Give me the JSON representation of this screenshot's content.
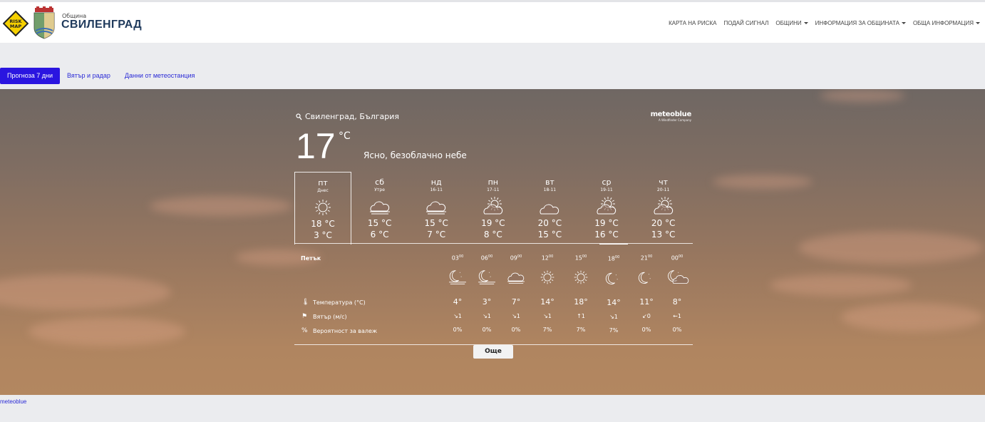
{
  "header": {
    "logo_text": "RISK MAP",
    "brand_small": "Община",
    "brand_big": "СВИЛЕНГРАД",
    "nav": [
      {
        "label": "КАРТА НА РИСКА",
        "dropdown": false
      },
      {
        "label": "ПОДАЙ СИГНАЛ",
        "dropdown": false
      },
      {
        "label": "ОБЩИНИ",
        "dropdown": true
      },
      {
        "label": "ИНФОРМАЦИЯ ЗА ОБЩИНАТА",
        "dropdown": true
      },
      {
        "label": "ОБЩА ИНФОРМАЦИЯ",
        "dropdown": true
      }
    ]
  },
  "tabs": [
    {
      "label": "Прогноза 7 дни",
      "active": true
    },
    {
      "label": "Вятър и радар",
      "active": false
    },
    {
      "label": "Данни от метеостанция",
      "active": false
    }
  ],
  "widget": {
    "location": "Свиленград, България",
    "provider": "meteoblue",
    "provider_sub": "A Windfinder Company",
    "current_temp": "17",
    "unit": "°C",
    "condition": "Ясно, безоблачно небе",
    "days": [
      {
        "name": "пт",
        "date": "Днес",
        "icon": "sun-icon",
        "hi": "18 °C",
        "lo": "3 °C",
        "selected": true
      },
      {
        "name": "сб",
        "date": "Утре",
        "icon": "fog-cloud-icon",
        "hi": "15 °C",
        "lo": "6 °C",
        "selected": false
      },
      {
        "name": "нд",
        "date": "16-11",
        "icon": "fog-cloud-icon",
        "hi": "15 °C",
        "lo": "7 °C",
        "selected": false
      },
      {
        "name": "пн",
        "date": "17-11",
        "icon": "sun-cloud-icon",
        "hi": "19 °C",
        "lo": "8 °C",
        "selected": false
      },
      {
        "name": "вт",
        "date": "18-11",
        "icon": "cloud-icon",
        "hi": "20 °C",
        "lo": "15 °C",
        "selected": false
      },
      {
        "name": "ср",
        "date": "19-11",
        "icon": "sun-cloud-icon",
        "hi": "19 °C",
        "lo": "16 °C",
        "selected": false
      },
      {
        "name": "чт",
        "date": "20-11",
        "icon": "sun-cloud-icon",
        "hi": "20 °C",
        "lo": "13 °C",
        "selected": false
      }
    ],
    "hourly_day": "Петък",
    "row_labels": {
      "temp": "Температура (°C)",
      "wind": "Вятър (м/с)",
      "precip": "Вероятност за валеж"
    },
    "hours": [
      {
        "h": "03",
        "m": "00",
        "icon": "moon-fog-icon",
        "temp": "4°",
        "wind": "1",
        "wind_dir": "↘",
        "precip": "0%"
      },
      {
        "h": "06",
        "m": "00",
        "icon": "moon-fog-icon",
        "temp": "3°",
        "wind": "1",
        "wind_dir": "↘",
        "precip": "0%"
      },
      {
        "h": "09",
        "m": "00",
        "icon": "fog-cloud-icon",
        "temp": "7°",
        "wind": "1",
        "wind_dir": "↘",
        "precip": "0%"
      },
      {
        "h": "12",
        "m": "00",
        "icon": "sun-icon",
        "temp": "14°",
        "wind": "1",
        "wind_dir": "↘",
        "precip": "7%"
      },
      {
        "h": "15",
        "m": "00",
        "icon": "sun-icon",
        "temp": "18°",
        "wind": "1",
        "wind_dir": "↑",
        "precip": "7%"
      },
      {
        "h": "18",
        "m": "00",
        "icon": "moon-icon",
        "temp": "14°",
        "wind": "1",
        "wind_dir": "↘",
        "precip": "7%"
      },
      {
        "h": "21",
        "m": "00",
        "icon": "moon-icon",
        "temp": "11°",
        "wind": "0",
        "wind_dir": "↙",
        "precip": "0%"
      },
      {
        "h": "00",
        "m": "00",
        "icon": "moon-cloud-icon",
        "temp": "8°",
        "wind": "1",
        "wind_dir": "←",
        "precip": "0%"
      }
    ],
    "current_hour_index": 5,
    "more_label": "Още"
  },
  "footer": {
    "link": "meteoblue"
  }
}
